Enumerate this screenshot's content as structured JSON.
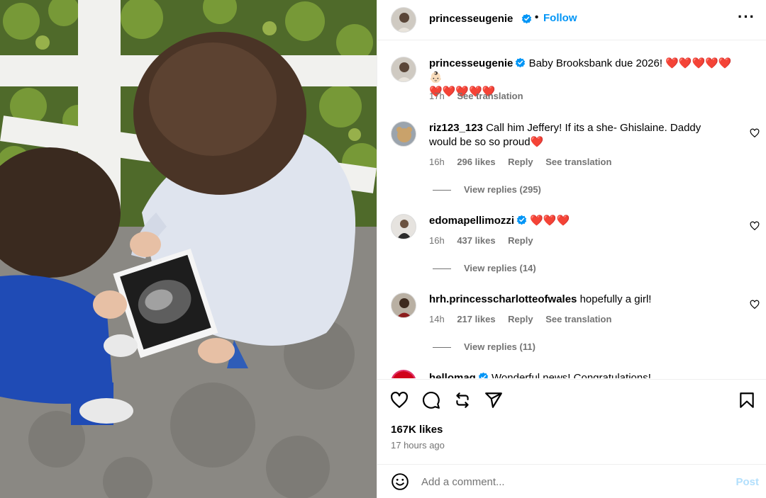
{
  "post": {
    "username": "princesseugenie",
    "follow_label": "Follow",
    "more_icon": "more-horizontal-icon",
    "caption_user": "princesseugenie",
    "caption_text_line1": "Baby Brooksbank due 2026! ❤️❤️❤️❤️❤️👶🏻",
    "caption_text_line2": "❤️❤️❤️❤️❤️",
    "caption_time": "17h",
    "see_translation": "See translation",
    "likes": "167K likes",
    "posted_ago": "17 hours ago"
  },
  "comments": [
    {
      "user": "riz123_123",
      "text_line1": "Call him Jeffery! If its a she- Ghislaine. Daddy",
      "text_line2": "would be so so proud❤️",
      "time": "16h",
      "likes": "296 likes",
      "reply": "Reply",
      "see_translation": "See translation",
      "view_replies": "View replies (295)"
    },
    {
      "user": "edomapellimozzi",
      "text_line1": "❤️❤️❤️",
      "time": "16h",
      "likes": "437 likes",
      "reply": "Reply",
      "view_replies": "View replies (14)"
    },
    {
      "user": "hrh.princesscharlotteofwales",
      "text_line1": "hopefully a girl!",
      "time": "14h",
      "likes": "217 likes",
      "reply": "Reply",
      "see_translation": "See translation",
      "view_replies": "View replies (11)"
    },
    {
      "user": "hellomag",
      "text_line1": "Wonderful news! Congratulations!"
    }
  ],
  "compose": {
    "placeholder": "Add a comment...",
    "post_label": "Post",
    "emoji_icon": "emoji-smile-icon"
  },
  "colors": {
    "link_blue": "#0095f6",
    "post_disabled": "#b2dffc",
    "meta_gray": "#737373",
    "heart_red": "#ff0b1f"
  }
}
